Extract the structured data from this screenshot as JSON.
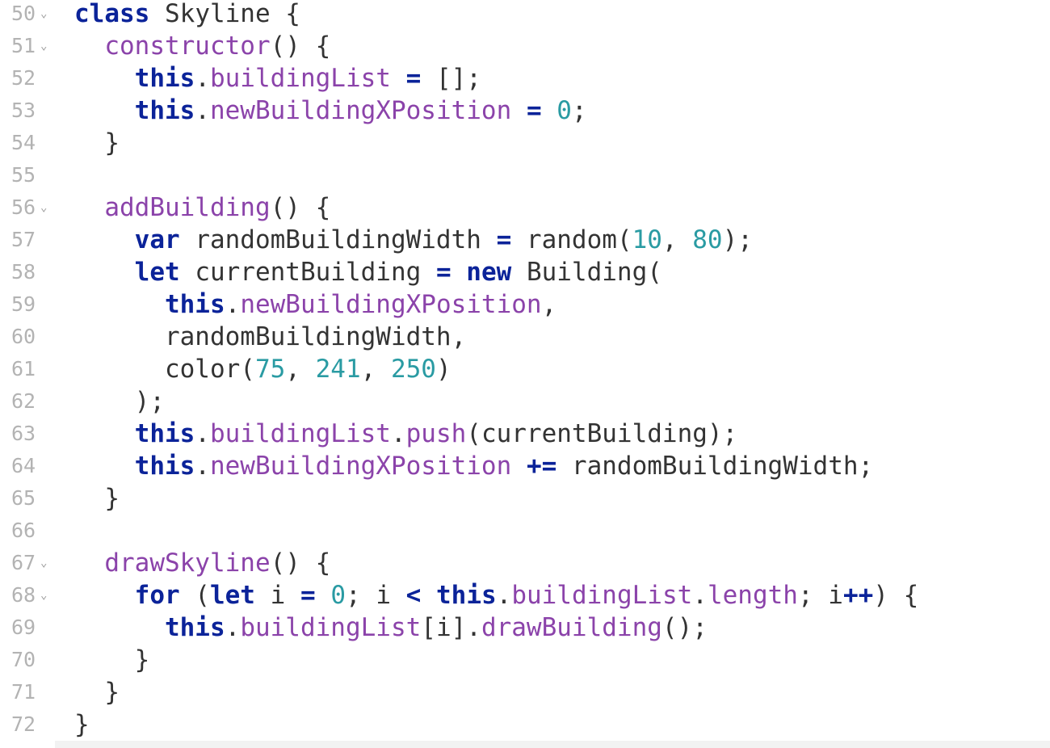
{
  "editor": {
    "fold_glyph": "⌄",
    "lines": [
      {
        "no": "50",
        "fold": true,
        "indent": 0,
        "tokens": [
          [
            "kw",
            "class"
          ],
          [
            "txt",
            " Skyline {"
          ]
        ]
      },
      {
        "no": "51",
        "fold": true,
        "indent": 1,
        "tokens": [
          [
            "prop",
            "constructor"
          ],
          [
            "txt",
            "() {"
          ]
        ]
      },
      {
        "no": "52",
        "fold": false,
        "indent": 2,
        "tokens": [
          [
            "kw",
            "this"
          ],
          [
            "txt",
            "."
          ],
          [
            "prop",
            "buildingList"
          ],
          [
            "txt",
            " "
          ],
          [
            "op",
            "="
          ],
          [
            "txt",
            " [];"
          ]
        ]
      },
      {
        "no": "53",
        "fold": false,
        "indent": 2,
        "tokens": [
          [
            "kw",
            "this"
          ],
          [
            "txt",
            "."
          ],
          [
            "prop",
            "newBuildingXPosition"
          ],
          [
            "txt",
            " "
          ],
          [
            "op",
            "="
          ],
          [
            "txt",
            " "
          ],
          [
            "num",
            "0"
          ],
          [
            "txt",
            ";"
          ]
        ]
      },
      {
        "no": "54",
        "fold": false,
        "indent": 1,
        "tokens": [
          [
            "txt",
            "}"
          ]
        ]
      },
      {
        "no": "55",
        "fold": false,
        "indent": 0,
        "tokens": []
      },
      {
        "no": "56",
        "fold": true,
        "indent": 1,
        "tokens": [
          [
            "prop",
            "addBuilding"
          ],
          [
            "txt",
            "() {"
          ]
        ]
      },
      {
        "no": "57",
        "fold": false,
        "indent": 2,
        "tokens": [
          [
            "kw",
            "var"
          ],
          [
            "txt",
            " randomBuildingWidth "
          ],
          [
            "op",
            "="
          ],
          [
            "txt",
            " random("
          ],
          [
            "num",
            "10"
          ],
          [
            "txt",
            ", "
          ],
          [
            "num",
            "80"
          ],
          [
            "txt",
            ");"
          ]
        ]
      },
      {
        "no": "58",
        "fold": false,
        "indent": 2,
        "tokens": [
          [
            "kw",
            "let"
          ],
          [
            "txt",
            " currentBuilding "
          ],
          [
            "op",
            "="
          ],
          [
            "txt",
            " "
          ],
          [
            "kw",
            "new"
          ],
          [
            "txt",
            " Building("
          ]
        ]
      },
      {
        "no": "59",
        "fold": false,
        "indent": 3,
        "tokens": [
          [
            "kw",
            "this"
          ],
          [
            "txt",
            "."
          ],
          [
            "prop",
            "newBuildingXPosition"
          ],
          [
            "txt",
            ","
          ]
        ]
      },
      {
        "no": "60",
        "fold": false,
        "indent": 3,
        "tokens": [
          [
            "txt",
            "randomBuildingWidth,"
          ]
        ]
      },
      {
        "no": "61",
        "fold": false,
        "indent": 3,
        "tokens": [
          [
            "txt",
            "color("
          ],
          [
            "num",
            "75"
          ],
          [
            "txt",
            ", "
          ],
          [
            "num",
            "241"
          ],
          [
            "txt",
            ", "
          ],
          [
            "num",
            "250"
          ],
          [
            "txt",
            ")"
          ]
        ]
      },
      {
        "no": "62",
        "fold": false,
        "indent": 2,
        "tokens": [
          [
            "txt",
            ");"
          ]
        ]
      },
      {
        "no": "63",
        "fold": false,
        "indent": 2,
        "tokens": [
          [
            "kw",
            "this"
          ],
          [
            "txt",
            "."
          ],
          [
            "prop",
            "buildingList"
          ],
          [
            "txt",
            "."
          ],
          [
            "prop",
            "push"
          ],
          [
            "txt",
            "(currentBuilding);"
          ]
        ]
      },
      {
        "no": "64",
        "fold": false,
        "indent": 2,
        "tokens": [
          [
            "kw",
            "this"
          ],
          [
            "txt",
            "."
          ],
          [
            "prop",
            "newBuildingXPosition"
          ],
          [
            "txt",
            " "
          ],
          [
            "op",
            "+="
          ],
          [
            "txt",
            " randomBuildingWidth;"
          ]
        ]
      },
      {
        "no": "65",
        "fold": false,
        "indent": 1,
        "tokens": [
          [
            "txt",
            "}"
          ]
        ]
      },
      {
        "no": "66",
        "fold": false,
        "indent": 0,
        "tokens": []
      },
      {
        "no": "67",
        "fold": true,
        "indent": 1,
        "tokens": [
          [
            "prop",
            "drawSkyline"
          ],
          [
            "txt",
            "() {"
          ]
        ]
      },
      {
        "no": "68",
        "fold": true,
        "indent": 2,
        "tokens": [
          [
            "kw",
            "for"
          ],
          [
            "txt",
            " ("
          ],
          [
            "kw",
            "let"
          ],
          [
            "txt",
            " i "
          ],
          [
            "op",
            "="
          ],
          [
            "txt",
            " "
          ],
          [
            "num",
            "0"
          ],
          [
            "txt",
            "; i "
          ],
          [
            "op",
            "<"
          ],
          [
            "txt",
            " "
          ],
          [
            "kw",
            "this"
          ],
          [
            "txt",
            "."
          ],
          [
            "prop",
            "buildingList"
          ],
          [
            "txt",
            "."
          ],
          [
            "prop",
            "length"
          ],
          [
            "txt",
            "; i"
          ],
          [
            "op",
            "++"
          ],
          [
            "txt",
            ") {"
          ]
        ]
      },
      {
        "no": "69",
        "fold": false,
        "indent": 3,
        "tokens": [
          [
            "kw",
            "this"
          ],
          [
            "txt",
            "."
          ],
          [
            "prop",
            "buildingList"
          ],
          [
            "txt",
            "[i]."
          ],
          [
            "prop",
            "drawBuilding"
          ],
          [
            "txt",
            "();"
          ]
        ]
      },
      {
        "no": "70",
        "fold": false,
        "indent": 2,
        "tokens": [
          [
            "txt",
            "}"
          ]
        ]
      },
      {
        "no": "71",
        "fold": false,
        "indent": 1,
        "tokens": [
          [
            "txt",
            "}"
          ]
        ]
      },
      {
        "no": "72",
        "fold": false,
        "indent": 0,
        "tokens": [
          [
            "txt",
            "}"
          ]
        ]
      }
    ]
  },
  "colors": {
    "keyword": "#0b2399",
    "property": "#8b43aa",
    "number": "#2a9ba3",
    "text": "#333333",
    "line_number": "#b3b3b3"
  }
}
